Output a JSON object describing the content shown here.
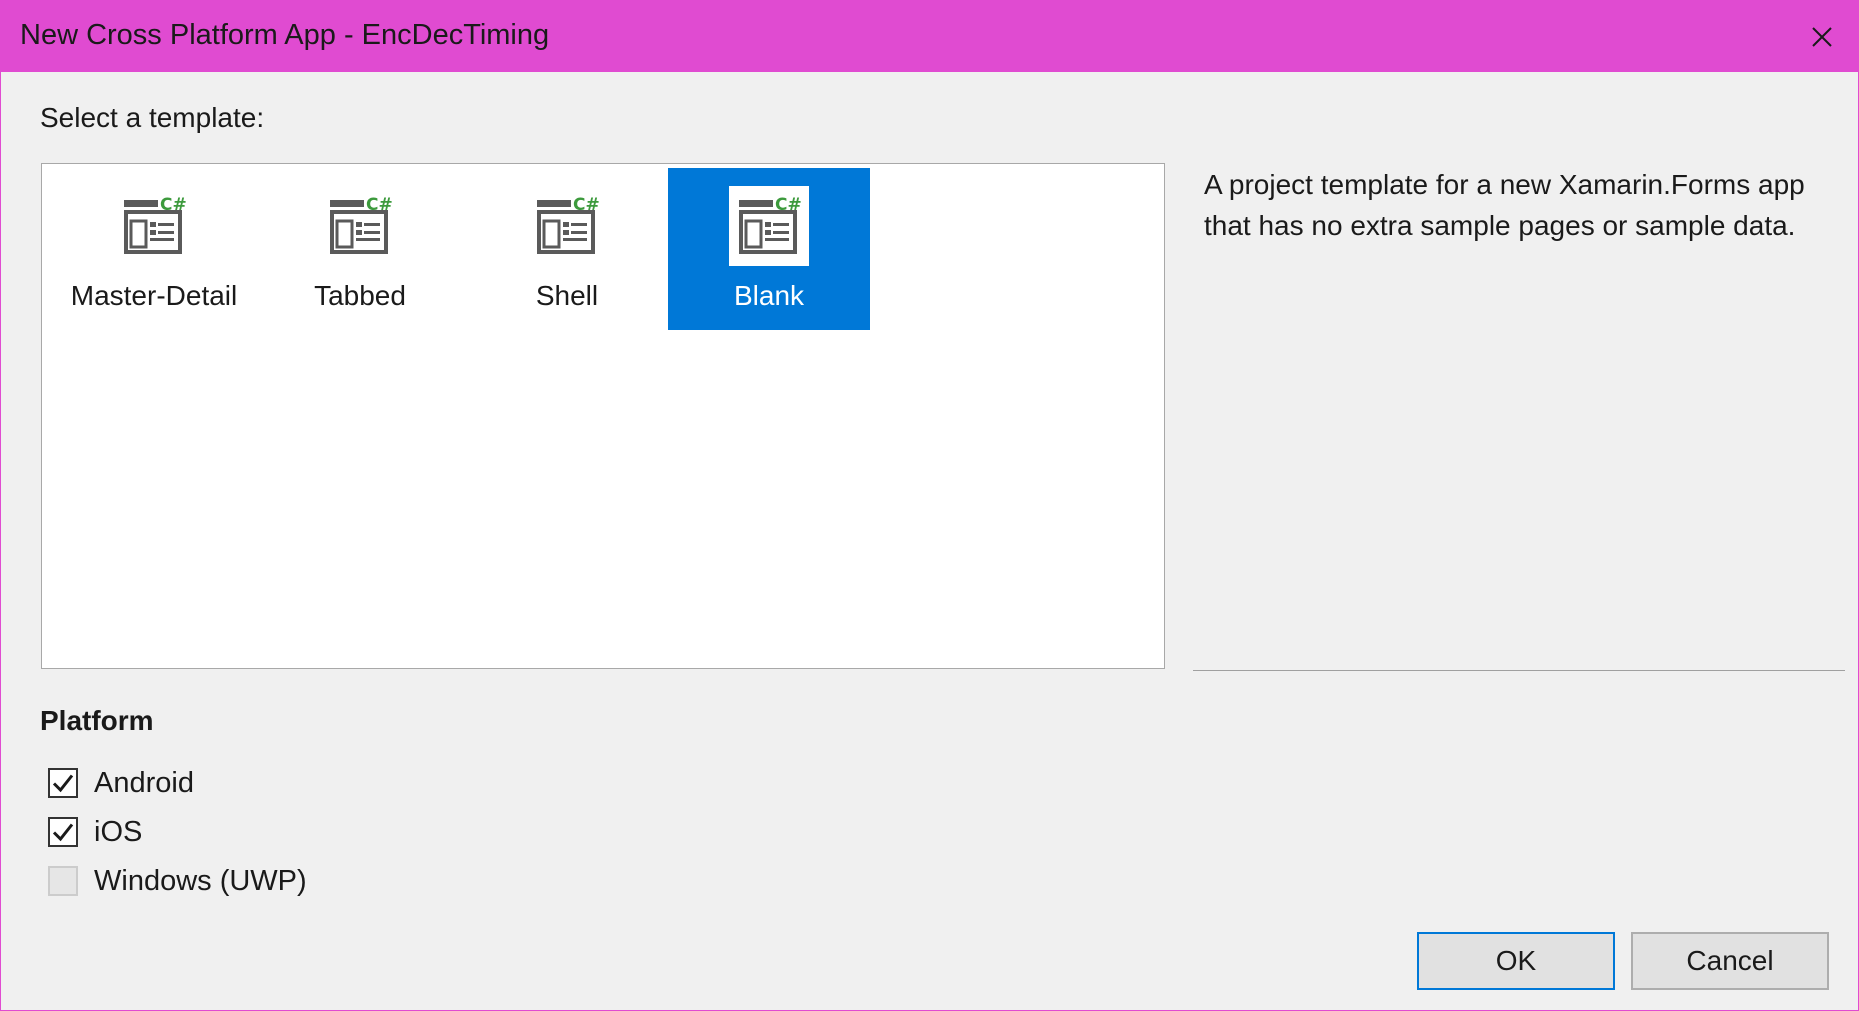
{
  "window": {
    "title": "New Cross Platform App - EncDecTiming",
    "close_icon": "close-icon",
    "title_bar_color": "#e04bd1"
  },
  "template_section": {
    "label": "Select a template:",
    "templates": [
      {
        "label": "Master-Detail",
        "icon": "xamarin-csharp-template-icon",
        "selected": false
      },
      {
        "label": "Tabbed",
        "icon": "xamarin-csharp-template-icon",
        "selected": false
      },
      {
        "label": "Shell",
        "icon": "xamarin-csharp-template-icon",
        "selected": false
      },
      {
        "label": "Blank",
        "icon": "xamarin-csharp-template-icon",
        "selected": true
      }
    ],
    "selection_color": "#0078d7"
  },
  "description": {
    "text": "A project template for a new Xamarin.Forms app that has no extra sample pages or sample data."
  },
  "platform": {
    "heading": "Platform",
    "options": [
      {
        "label": "Android",
        "checked": true,
        "enabled": true
      },
      {
        "label": "iOS",
        "checked": true,
        "enabled": true
      },
      {
        "label": "Windows (UWP)",
        "checked": false,
        "enabled": false
      }
    ]
  },
  "buttons": {
    "ok_label": "OK",
    "cancel_label": "Cancel"
  }
}
